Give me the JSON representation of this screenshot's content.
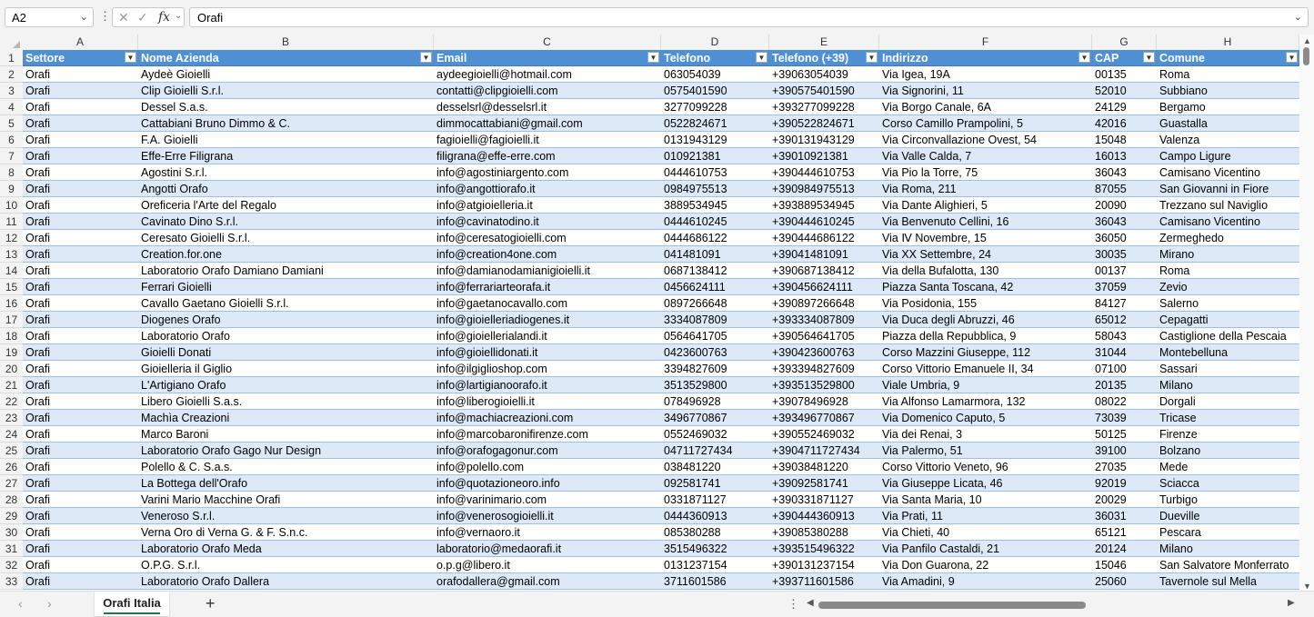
{
  "formula_bar": {
    "name_box": "A2",
    "fx_label": "fx",
    "formula": "Orafi"
  },
  "columns": [
    {
      "letter": "A",
      "header": "Settore"
    },
    {
      "letter": "B",
      "header": "Nome Azienda"
    },
    {
      "letter": "C",
      "header": "Email"
    },
    {
      "letter": "D",
      "header": "Telefono"
    },
    {
      "letter": "E",
      "header": "Telefono (+39)"
    },
    {
      "letter": "F",
      "header": "Indirizzo"
    },
    {
      "letter": "G",
      "header": "CAP"
    },
    {
      "letter": "H",
      "header": "Comune"
    }
  ],
  "header_row_number": "1",
  "rows": [
    {
      "n": "2",
      "cells": [
        "Orafi",
        "Aydeè Gioielli",
        "aydeegioielli@hotmail.com",
        "063054039",
        "+39063054039",
        "Via Igea, 19A",
        "00135",
        "Roma"
      ]
    },
    {
      "n": "3",
      "cells": [
        "Orafi",
        "Clip Gioielli S.r.l.",
        "contatti@clipgioielli.com",
        "0575401590",
        "+390575401590",
        "Via Signorini, 11",
        "52010",
        "Subbiano"
      ]
    },
    {
      "n": "4",
      "cells": [
        "Orafi",
        "Dessel S.a.s.",
        "desselsrl@desselsrl.it",
        "3277099228",
        "+393277099228",
        "Via Borgo Canale, 6A",
        "24129",
        "Bergamo"
      ]
    },
    {
      "n": "5",
      "cells": [
        "Orafi",
        "Cattabiani Bruno Dimmo & C.",
        "dimmocattabiani@gmail.com",
        "0522824671",
        "+390522824671",
        "Corso Camillo Prampolini, 5",
        "42016",
        "Guastalla"
      ]
    },
    {
      "n": "6",
      "cells": [
        "Orafi",
        "F.A. Gioielli",
        "fagioielli@fagioielli.it",
        "0131943129",
        "+390131943129",
        "Via Circonvallazione Ovest, 54",
        "15048",
        "Valenza"
      ]
    },
    {
      "n": "7",
      "cells": [
        "Orafi",
        "Effe-Erre Filigrana",
        "filigrana@effe-erre.com",
        "010921381",
        "+39010921381",
        "Via Valle Calda, 7",
        "16013",
        "Campo Ligure"
      ]
    },
    {
      "n": "8",
      "cells": [
        "Orafi",
        "Agostini S.r.l.",
        "info@agostiniargento.com",
        "0444610753",
        "+390444610753",
        "Via Pio la Torre, 75",
        "36043",
        "Camisano Vicentino"
      ]
    },
    {
      "n": "9",
      "cells": [
        "Orafi",
        "Angotti Orafo",
        "info@angottiorafo.it",
        "0984975513",
        "+390984975513",
        "Via Roma, 211",
        "87055",
        "San Giovanni in Fiore"
      ]
    },
    {
      "n": "10",
      "cells": [
        "Orafi",
        "Oreficeria l'Arte del Regalo",
        "info@atgioielleria.it",
        "3889534945",
        "+393889534945",
        "Via Dante Alighieri, 5",
        "20090",
        "Trezzano sul Naviglio"
      ]
    },
    {
      "n": "11",
      "cells": [
        "Orafi",
        "Cavinato Dino S.r.l.",
        "info@cavinatodino.it",
        "0444610245",
        "+390444610245",
        "Via Benvenuto Cellini, 16",
        "36043",
        "Camisano Vicentino"
      ]
    },
    {
      "n": "12",
      "cells": [
        "Orafi",
        "Ceresato Gioielli S.r.l.",
        "info@ceresatogioielli.com",
        "0444686122",
        "+390444686122",
        "Via Ⅳ Novembre, 15",
        "36050",
        "Zermeghedo"
      ]
    },
    {
      "n": "13",
      "cells": [
        "Orafi",
        "Creation.for.one",
        "info@creation4one.com",
        "041481091",
        "+39041481091",
        "Via XX Settembre, 24",
        "30035",
        "Mirano"
      ]
    },
    {
      "n": "14",
      "cells": [
        "Orafi",
        "Laboratorio Orafo Damiano Damiani",
        "info@damianodamianigioielli.it",
        "0687138412",
        "+390687138412",
        "Via della Bufalotta, 130",
        "00137",
        "Roma"
      ]
    },
    {
      "n": "15",
      "cells": [
        "Orafi",
        "Ferrari Gioielli",
        "info@ferrariarteorafa.it",
        "0456624111",
        "+390456624111",
        "Piazza Santa Toscana, 42",
        "37059",
        "Zevio"
      ]
    },
    {
      "n": "16",
      "cells": [
        "Orafi",
        "Cavallo Gaetano Gioielli S.r.l.",
        "info@gaetanocavallo.com",
        "0897266648",
        "+390897266648",
        "Via Posidonia, 155",
        "84127",
        "Salerno"
      ]
    },
    {
      "n": "17",
      "cells": [
        "Orafi",
        "Diogenes Orafo",
        "info@gioielleriadiogenes.it",
        "3334087809",
        "+393334087809",
        "Via Duca degli Abruzzi, 46",
        "65012",
        "Cepagatti"
      ]
    },
    {
      "n": "18",
      "cells": [
        "Orafi",
        "Laboratorio Orafo",
        "info@gioiellerialandi.it",
        "0564641705",
        "+390564641705",
        "Piazza della Repubblica, 9",
        "58043",
        "Castiglione della Pescaia"
      ]
    },
    {
      "n": "19",
      "cells": [
        "Orafi",
        "Gioielli Donati",
        "info@gioiellidonati.it",
        "0423600763",
        "+390423600763",
        "Corso Mazzini Giuseppe, 112",
        "31044",
        "Montebelluna"
      ]
    },
    {
      "n": "20",
      "cells": [
        "Orafi",
        "Gioielleria il Giglio",
        "info@ilgiglioshop.com",
        "3394827609",
        "+393394827609",
        "Corso Vittorio Emanuele II, 34",
        "07100",
        "Sassari"
      ]
    },
    {
      "n": "21",
      "cells": [
        "Orafi",
        "L'Artigiano Orafo",
        "info@lartigianoorafo.it",
        "3513529800",
        "+393513529800",
        "Viale Umbria, 9",
        "20135",
        "Milano"
      ]
    },
    {
      "n": "22",
      "cells": [
        "Orafi",
        "Libero Gioielli S.a.s.",
        "info@liberogioielli.it",
        "078496928",
        "+39078496928",
        "Via Alfonso Lamarmora, 132",
        "08022",
        "Dorgali"
      ]
    },
    {
      "n": "23",
      "cells": [
        "Orafi",
        "Machìa Creazioni",
        "info@machiacreazioni.com",
        "3496770867",
        "+393496770867",
        "Via Domenico Caputo, 5",
        "73039",
        "Tricase"
      ]
    },
    {
      "n": "24",
      "cells": [
        "Orafi",
        "Marco Baroni",
        "info@marcobaronifirenze.com",
        "0552469032",
        "+390552469032",
        "Via dei Renai, 3",
        "50125",
        "Firenze"
      ]
    },
    {
      "n": "25",
      "cells": [
        "Orafi",
        "Laboratorio Orafo Gago Nur Design",
        "info@orafogagonur.com",
        "04711727434",
        "+3904711727434",
        "Via Palermo, 51",
        "39100",
        "Bolzano"
      ]
    },
    {
      "n": "26",
      "cells": [
        "Orafi",
        "Polello & C. S.a.s.",
        "info@polello.com",
        "038481220",
        "+39038481220",
        "Corso Vittorio Veneto, 96",
        "27035",
        "Mede"
      ]
    },
    {
      "n": "27",
      "cells": [
        "Orafi",
        "La Bottega dell'Orafo",
        "info@quotazioneoro.info",
        "092581741",
        "+39092581741",
        "Via Giuseppe Licata, 46",
        "92019",
        "Sciacca"
      ]
    },
    {
      "n": "28",
      "cells": [
        "Orafi",
        "Varini Mario Macchine Orafi",
        "info@varinimario.com",
        "0331871127",
        "+390331871127",
        "Via Santa Maria, 10",
        "20029",
        "Turbigo"
      ]
    },
    {
      "n": "29",
      "cells": [
        "Orafi",
        "Veneroso S.r.l.",
        "info@venerosogioielli.it",
        "0444360913",
        "+390444360913",
        "Via Prati, 11",
        "36031",
        "Dueville"
      ]
    },
    {
      "n": "30",
      "cells": [
        "Orafi",
        "Verna Oro di Verna G. & F. S.n.c.",
        "info@vernaoro.it",
        "085380288",
        "+39085380288",
        "Via Chieti, 40",
        "65121",
        "Pescara"
      ]
    },
    {
      "n": "31",
      "cells": [
        "Orafi",
        "Laboratorio Orafo Meda",
        "laboratorio@medaorafi.it",
        "3515496322",
        "+393515496322",
        "Via Panfilo Castaldi, 21",
        "20124",
        "Milano"
      ]
    },
    {
      "n": "32",
      "cells": [
        "Orafi",
        "O.P.G. S.r.l.",
        "o.p.g@libero.it",
        "0131237154",
        "+390131237154",
        "Via Don Guarona, 22",
        "15046",
        "San Salvatore Monferrato"
      ]
    },
    {
      "n": "33",
      "cells": [
        "Orafi",
        "Laboratorio Orafo Dallera",
        "orafodallera@gmail.com",
        "3711601586",
        "+393711601586",
        "Via Amadini, 9",
        "25060",
        "Tavernole sul Mella"
      ]
    }
  ],
  "sheet_tabs": [
    {
      "label": "Orafi Italia",
      "active": true
    }
  ],
  "icons": {
    "namebox_caret": "chevron-down-icon",
    "cancel": "close-icon",
    "enter": "check-icon",
    "filter": "filter-dropdown-icon",
    "add_sheet": "plus-icon"
  },
  "colors": {
    "header_fill": "#4f8fd4",
    "band_fill": "#dde9f6",
    "sheet_tab_accent": "#1f7a3f"
  }
}
